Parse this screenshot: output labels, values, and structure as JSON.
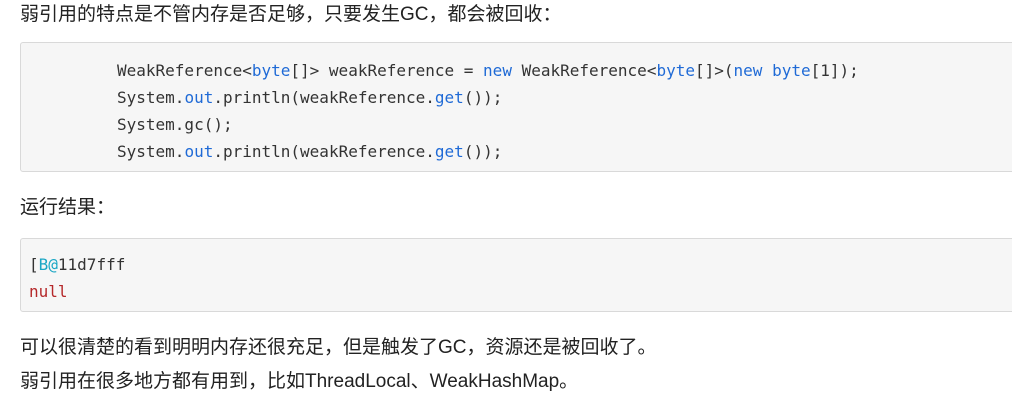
{
  "paragraphs": {
    "intro": "弱引用的特点是不管内存是否足够，只要发生GC，都会被回收：",
    "result_label": "运行结果：",
    "conclusion": "可以很清楚的看到明明内存还很充足，但是触发了GC，资源还是被回收了。",
    "usage": "弱引用在很多地方都有用到，比如ThreadLocal、WeakHashMap。"
  },
  "code_block": {
    "line1": {
      "a": "WeakReference<",
      "b": "byte",
      "c": "[]> weakReference = ",
      "d": "new",
      "e": " WeakReference<",
      "f": "byte",
      "g": "[]>(",
      "h": "new",
      "i": " ",
      "j": "byte",
      "k": "[1]);"
    },
    "line2": {
      "a": "System.",
      "b": "out",
      "c": ".println(weakReference.",
      "d": "get",
      "e": "());"
    },
    "line3": {
      "a": "System.gc();"
    },
    "line4": {
      "a": "System.",
      "b": "out",
      "c": ".println(weakReference.",
      "d": "get",
      "e": "());"
    }
  },
  "output_block": {
    "line1": {
      "a": "[",
      "b": "B@",
      "c": "11d7fff"
    },
    "line2": "null"
  },
  "colors": {
    "keyword": "#1f6ad6",
    "null_literal": "#b5282a",
    "output_type": "#1aa6c4"
  }
}
